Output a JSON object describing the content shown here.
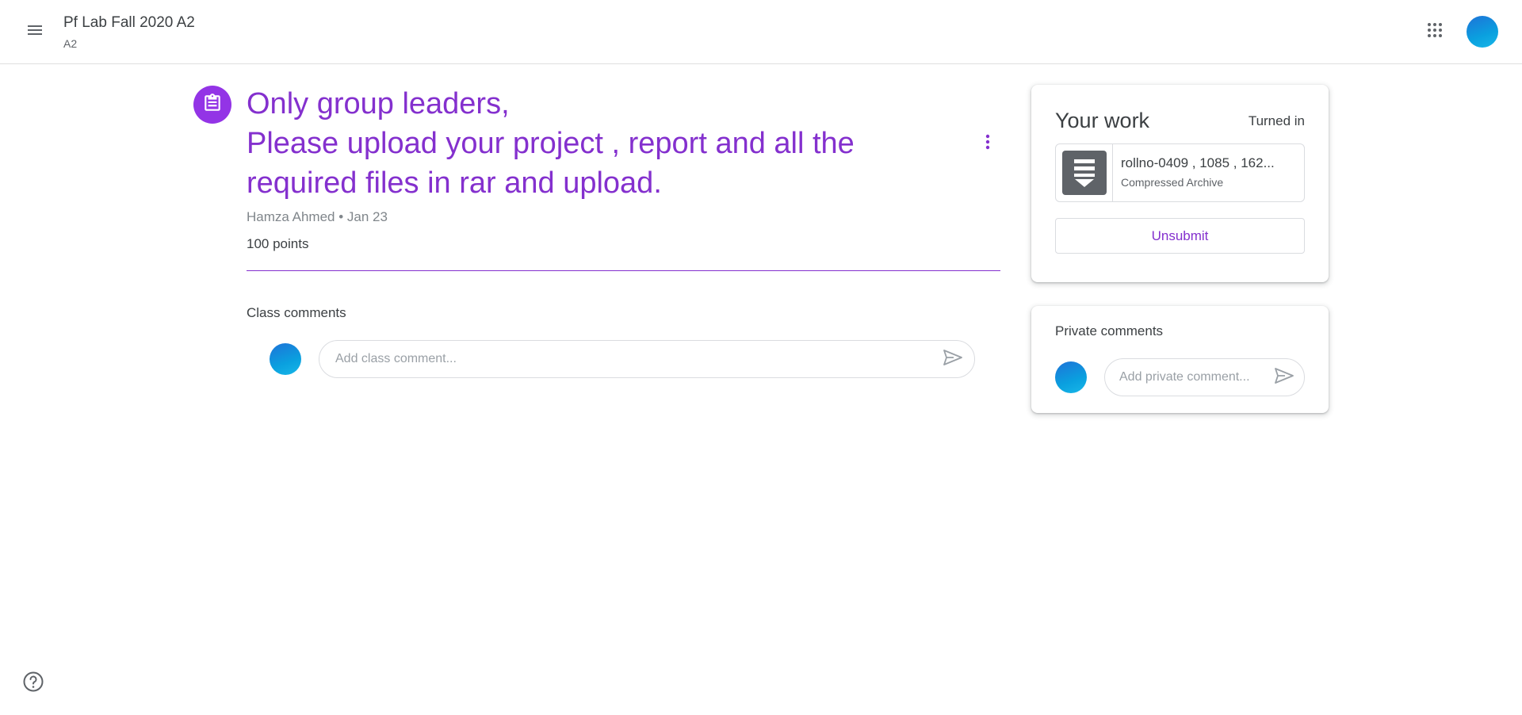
{
  "header": {
    "class_title": "Pf Lab Fall 2020 A2",
    "class_section": "A2",
    "menu_icon": "hamburger-menu-icon",
    "apps_icon": "google-apps-grid-icon"
  },
  "assignment": {
    "icon": "assignment-clipboard-icon",
    "title_lines": [
      "Only group leaders,",
      "Please upload your project , report and all the",
      "required files in rar and upload."
    ],
    "author": "Hamza Ahmed",
    "separator": "•",
    "date": "Jan 23",
    "points": "100 points",
    "accent_color": "#8430ce",
    "icon_bg_color": "#9334e6"
  },
  "class_comments": {
    "label": "Class comments",
    "placeholder": "Add class comment...",
    "send_icon": "send-icon"
  },
  "your_work": {
    "title": "Your work",
    "status": "Turned in",
    "file": {
      "name": "rollno-0409 , 1085 , 162...",
      "type": "Compressed Archive",
      "icon": "archive-download-icon"
    },
    "unsubmit_label": "Unsubmit"
  },
  "private_comments": {
    "title": "Private comments",
    "placeholder": "Add private comment...",
    "send_icon": "send-icon"
  },
  "help_icon": "help-circle-icon"
}
